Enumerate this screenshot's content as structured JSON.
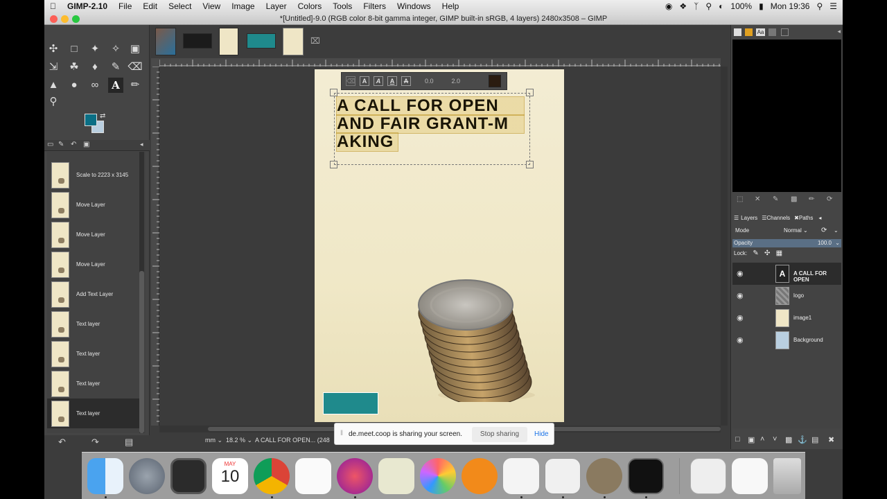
{
  "menubar": {
    "app_name": "GIMP-2.10",
    "items": [
      "File",
      "Edit",
      "Select",
      "View",
      "Image",
      "Layer",
      "Colors",
      "Tools",
      "Filters",
      "Windows",
      "Help"
    ],
    "battery": "100%",
    "clock": "Mon 19:36"
  },
  "window": {
    "title": "*[Untitled]-9.0 (RGB color 8-bit gamma integer, GIMP built-in sRGB, 4 layers) 2480x3508 – GIMP"
  },
  "colors": {
    "foreground": "#0a6f85",
    "background": "#b9cfe0",
    "accent_text_color": "#2b1c10"
  },
  "history": {
    "items": [
      {
        "label": "Scale to 2223 x 3145",
        "selected": false
      },
      {
        "label": "Move Layer",
        "selected": false
      },
      {
        "label": "Move Layer",
        "selected": false
      },
      {
        "label": "Move Layer",
        "selected": false
      },
      {
        "label": "Add Text Layer",
        "selected": false
      },
      {
        "label": "Text layer",
        "selected": false
      },
      {
        "label": "Text layer",
        "selected": false
      },
      {
        "label": "Text layer",
        "selected": false
      },
      {
        "label": "Text layer",
        "selected": true
      }
    ]
  },
  "canvas": {
    "text_lines": [
      "A CALL FOR OPEN",
      "AND FAIR GRANT-M",
      "AKING"
    ],
    "style_baseline": "0.0",
    "style_kerning": "2.0"
  },
  "statusbar": {
    "unit": "mm",
    "zoom": "18.2 %",
    "status": "A CALL FOR OPEN... (248"
  },
  "share_banner": {
    "message": "de.meet.coop is sharing your screen.",
    "stop_label": "Stop sharing",
    "hide_label": "Hide"
  },
  "layers_panel": {
    "tabs": [
      "Layers",
      "Channels",
      "Paths"
    ],
    "mode_label": "Mode",
    "mode_value": "Normal",
    "opacity_label": "Opacity",
    "opacity_value": "100.0",
    "lock_label": "Lock:",
    "layers": [
      {
        "name": "A CALL FOR OPEN",
        "selected": true
      },
      {
        "name": "logo",
        "selected": false
      },
      {
        "name": "image1",
        "selected": false
      },
      {
        "name": "Background",
        "selected": false
      }
    ]
  },
  "dock": {
    "calendar_month": "MAY",
    "calendar_day": "10"
  }
}
